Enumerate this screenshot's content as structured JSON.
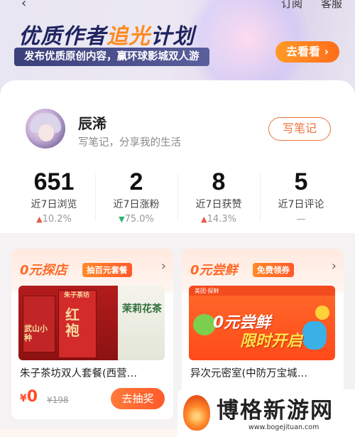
{
  "top_bar": {
    "back_icon": "chevron-left-icon",
    "subscribe_label": "订阅",
    "service_label": "客服"
  },
  "banner": {
    "title_part1": "优质作者",
    "title_highlight": "追光",
    "title_part2": "计划",
    "subtitle": "发布优质原创内容，赢环球影城双人游",
    "cta_label": "去看看",
    "cta_icon": "arrow-right-icon"
  },
  "profile": {
    "username": "辰浠",
    "bio": "写笔记，分享我的生活",
    "write_button": "写笔记"
  },
  "stats": [
    {
      "value": "651",
      "label": "近7日浏览",
      "trend": "up",
      "change": "10.2%"
    },
    {
      "value": "2",
      "label": "近7日涨粉",
      "trend": "down",
      "change": "75.0%"
    },
    {
      "value": "8",
      "label": "近7日获赞",
      "trend": "up",
      "change": "14.3%"
    },
    {
      "value": "5",
      "label": "近7日评论",
      "trend": "none",
      "change": "—"
    }
  ],
  "colors": {
    "accent": "#ff6a28",
    "up": "#e8594a",
    "down": "#2bb673",
    "banner_dark": "#1f2460"
  },
  "promos": [
    {
      "title": "0元探店",
      "tag": "抽百元套餐",
      "item_name": "朱子茶坊双人套餐(西营…",
      "price_symbol": "¥",
      "price": "0",
      "original_price": "¥198",
      "button": "去抽奖",
      "image_texts": {
        "a": "武山小种",
        "b": "红袍",
        "c": "茉莉花茶",
        "d": "朱子茶坊"
      }
    },
    {
      "title": "0元尝鲜",
      "tag": "免费领券",
      "item_name": "异次元密室(中防万宝城…",
      "image_texts": {
        "header": "美团·探鲜",
        "line1": "0元尝鲜",
        "line2": "限时开启"
      }
    }
  ],
  "watermark": {
    "title": "博格新游网",
    "url": "www.bogejituan.com"
  }
}
